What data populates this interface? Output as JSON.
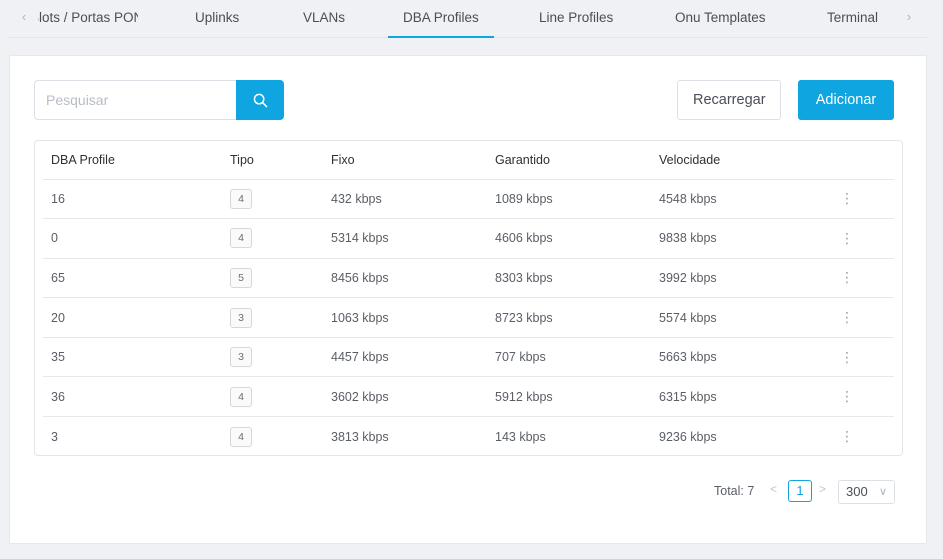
{
  "tabs": {
    "items": [
      {
        "label": "Slots / Portas PON",
        "active": false
      },
      {
        "label": "Uplinks",
        "active": false
      },
      {
        "label": "VLANs",
        "active": false
      },
      {
        "label": "DBA Profiles",
        "active": true
      },
      {
        "label": "Line Profiles",
        "active": false
      },
      {
        "label": "Onu Templates",
        "active": false
      },
      {
        "label": "Terminal",
        "active": false
      }
    ],
    "prev_icon": "chevron-left-icon",
    "next_icon": "chevron-right-icon"
  },
  "toolbar": {
    "search_placeholder": "Pesquisar",
    "search_value": "",
    "search_icon": "search-icon",
    "reload_label": "Recarregar",
    "add_label": "Adicionar"
  },
  "table": {
    "columns": [
      "DBA Profile",
      "Tipo",
      "Fixo",
      "Garantido",
      "Velocidade"
    ],
    "rows": [
      {
        "name": "16",
        "tipo": "4",
        "fixo": "432 kbps",
        "garantido": "1089 kbps",
        "velocidade": "4548 kbps"
      },
      {
        "name": "0",
        "tipo": "4",
        "fixo": "5314 kbps",
        "garantido": "4606 kbps",
        "velocidade": "9838 kbps"
      },
      {
        "name": "65",
        "tipo": "5",
        "fixo": "8456 kbps",
        "garantido": "8303 kbps",
        "velocidade": "3992 kbps"
      },
      {
        "name": "20",
        "tipo": "3",
        "fixo": "1063 kbps",
        "garantido": "8723 kbps",
        "velocidade": "5574 kbps"
      },
      {
        "name": "35",
        "tipo": "3",
        "fixo": "4457 kbps",
        "garantido": "707 kbps",
        "velocidade": "5663 kbps"
      },
      {
        "name": "36",
        "tipo": "4",
        "fixo": "3602 kbps",
        "garantido": "5912 kbps",
        "velocidade": "6315 kbps"
      },
      {
        "name": "3",
        "tipo": "4",
        "fixo": "3813 kbps",
        "garantido": "143 kbps",
        "velocidade": "9236 kbps"
      }
    ],
    "row_action_icon": "more-vertical-icon"
  },
  "pagination": {
    "total_label": "Total: 7",
    "current_page": "1",
    "page_size": "300"
  },
  "colors": {
    "accent": "#0ea5e0",
    "background": "#f0f1f5",
    "card": "#ffffff"
  }
}
